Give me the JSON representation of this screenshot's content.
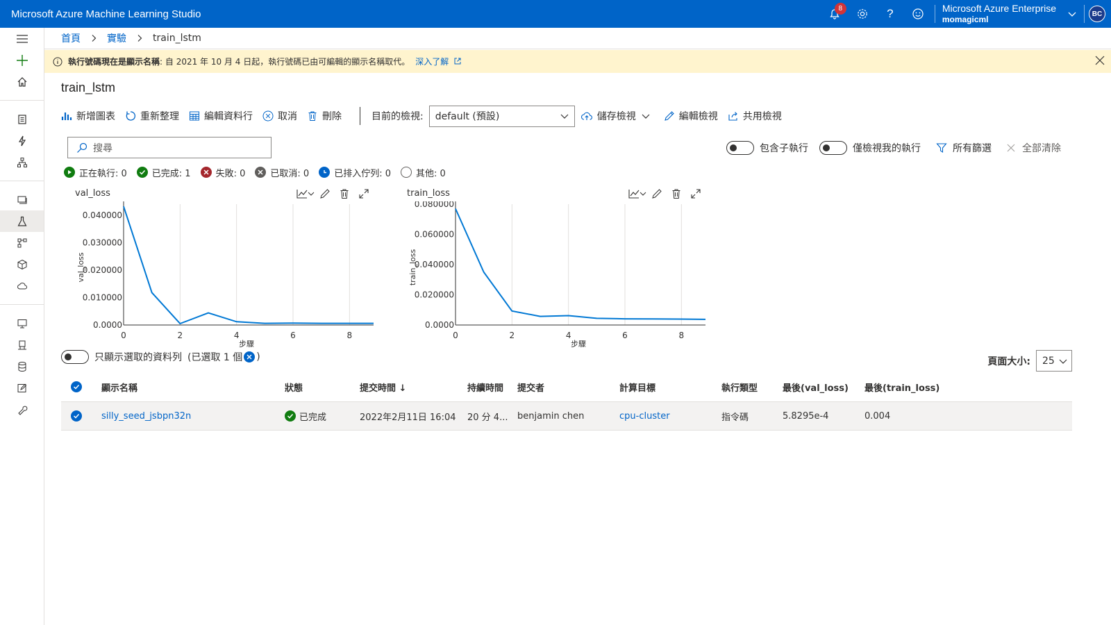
{
  "app": {
    "title": "Microsoft Azure Machine Learning Studio",
    "notification_count": "8",
    "directory": "Microsoft Azure Enterprise",
    "workspace": "momagicml",
    "avatar_initials": "BC",
    "accent": "#0064c8"
  },
  "breadcrumb": {
    "home": "首頁",
    "experiments": "實驗",
    "current": "train_lstm"
  },
  "banner": {
    "bold_text": "執行號碼現在是顯示名稱",
    "text": ": 自 2021 年 10 月 4 日起，執行號碼已由可編輯的顯示名稱取代。",
    "learn_more": "深入了解"
  },
  "page": {
    "title": "train_lstm"
  },
  "toolbar": {
    "add_chart": "新增圖表",
    "refresh": "重新整理",
    "edit_columns": "編輯資料行",
    "cancel": "取消",
    "delete": "刪除",
    "current_view_label": "目前的檢視:",
    "current_view_value": "default (預設)",
    "save_view": "儲存檢視",
    "edit_view": "編輯檢視",
    "share_view": "共用檢視"
  },
  "search": {
    "placeholder": "搜尋"
  },
  "filters": {
    "include_child_runs": "包含子執行",
    "only_my_runs": "僅檢視我的執行",
    "all_filters": "所有篩選",
    "clear_all": "全部清除"
  },
  "status_counts": [
    {
      "label": "正在執行: 0",
      "color": "#107c10"
    },
    {
      "label": "已完成: 1",
      "color": "#107c10"
    },
    {
      "label": "失敗: 0",
      "color": "#a4262c"
    },
    {
      "label": "已取消: 0",
      "color": "#605e5c"
    },
    {
      "label": "已排入佇列: 0",
      "color": "#0064c8"
    },
    {
      "label": "其他: 0",
      "color": "#605e5c"
    }
  ],
  "chart_data": [
    {
      "type": "line",
      "title": "val_loss",
      "xlabel": "步驟",
      "ylabel": "val_loss",
      "x": [
        0,
        1,
        2,
        3,
        4,
        5,
        6,
        7,
        8,
        9
      ],
      "series": [
        {
          "values": [
            0.0432,
            0.0118,
            0.0005,
            0.0044,
            0.0012,
            0.0006,
            0.0007,
            0.0006,
            0.0006,
            0.00058295
          ]
        }
      ],
      "xlim": [
        0,
        9
      ],
      "ylim": [
        0,
        0.044
      ],
      "xticks": [
        "0",
        "2",
        "4",
        "6",
        "8"
      ],
      "yticks": [
        "0.0000",
        "0.010000",
        "0.020000",
        "0.030000",
        "0.040000"
      ],
      "grid": true,
      "color": "#0078d4"
    },
    {
      "type": "line",
      "title": "train_loss",
      "xlabel": "步驟",
      "ylabel": "train_loss",
      "x": [
        0,
        1,
        2,
        3,
        4,
        5,
        6,
        7,
        8,
        9
      ],
      "series": [
        {
          "values": [
            0.077,
            0.035,
            0.0093,
            0.0057,
            0.0062,
            0.0044,
            0.0041,
            0.004,
            0.0039,
            0.0037
          ]
        }
      ],
      "xlim": [
        0,
        9
      ],
      "ylim": [
        0,
        0.08
      ],
      "xticks": [
        "0",
        "2",
        "4",
        "6",
        "8"
      ],
      "yticks": [
        "0.0000",
        "0.020000",
        "0.040000",
        "0.060000",
        "0.080000"
      ],
      "grid": true,
      "color": "#0078d4"
    }
  ],
  "selection": {
    "label": "只顯示選取的資料列",
    "count_text_before": "(已選取 1 個",
    "count_text_after": ")",
    "page_size_label": "頁面大小:",
    "page_size_value": "25"
  },
  "table": {
    "columns": [
      "顯示名稱",
      "狀態",
      "提交時間 ↓",
      "持續時間",
      "提交者",
      "計算目標",
      "執行類型",
      "最後(val_loss)",
      "最後(train_loss)"
    ],
    "rows": [
      {
        "name": "silly_seed_jsbpn32n",
        "status": "已完成",
        "submitted": "2022年2月11日 16:04",
        "duration": "20 分 4...",
        "submitter": "benjamin chen",
        "compute": "cpu-cluster",
        "run_type": "指令碼",
        "last_val_loss": "5.8295e-4",
        "last_train_loss": "0.004"
      }
    ]
  }
}
